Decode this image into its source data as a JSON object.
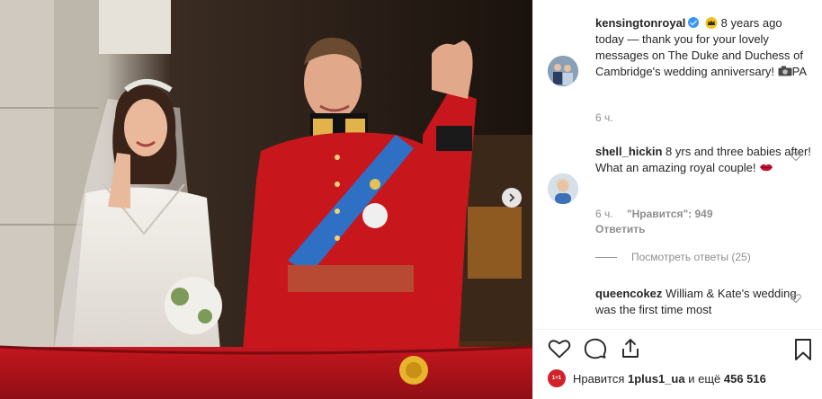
{
  "photo": {
    "description_icon": "carousel-next-icon"
  },
  "post": {
    "username": "kensingtonroyal",
    "verified_icon": "verified-badge-icon",
    "caption_emoji_icon": "crown-emoji-icon",
    "caption": "8 years ago today — thank you for your lovely messages on The Duke and Duchess of Cambridge's wedding anniversary!",
    "caption_credit_icon": "camera-emoji-icon",
    "caption_credit": "PA",
    "time": "6 ч."
  },
  "comments": [
    {
      "username": "shell_hickin",
      "text": "8 yrs and three babies after! What an amazing royal couple!",
      "emoji_icon": "lips-emoji-icon",
      "time": "6 ч.",
      "likes_label": "\"Нравится\": 949",
      "reply_label": "Ответить"
    },
    {
      "username": "queencokez",
      "text": "William & Kate's wedding was the first time most"
    }
  ],
  "view_replies": "Посмотреть ответы (25)",
  "actions": {
    "like_icon": "heart-icon",
    "comment_icon": "comment-icon",
    "share_icon": "share-icon",
    "save_icon": "bookmark-icon"
  },
  "likes": {
    "avatar_text": "1+1",
    "prefix": "Нравится",
    "user": "1plus1_ua",
    "suffix": "и ещё",
    "count": "456 516"
  },
  "colors": {
    "accent": "#3897f0",
    "tunic_red": "#c8161d",
    "sash_blue": "#2f6fc4",
    "balcony_red": "#b3121a"
  }
}
